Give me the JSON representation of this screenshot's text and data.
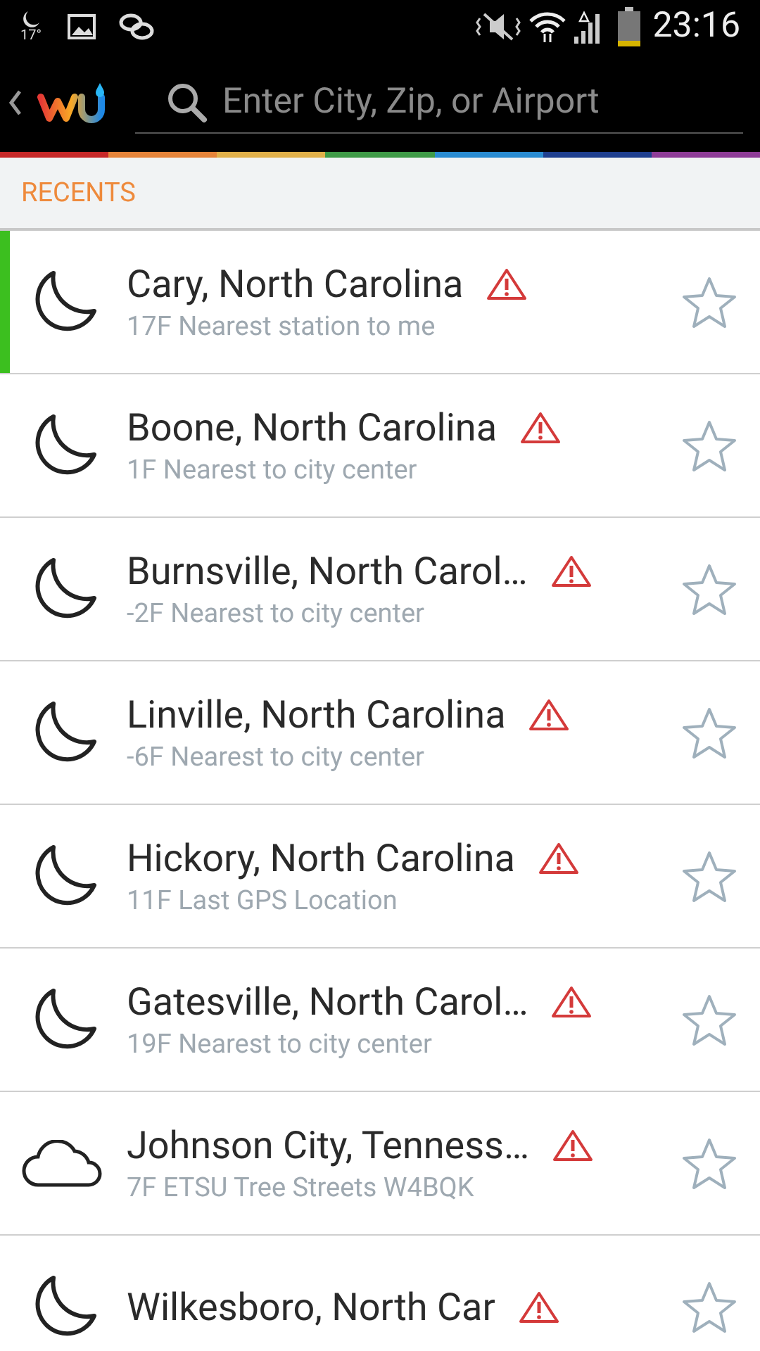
{
  "status_bar": {
    "temperature": "17°",
    "time": "23:16"
  },
  "search": {
    "placeholder": "Enter City, Zip, or Airport"
  },
  "section_title": "RECENTS",
  "locations": [
    {
      "name": "Cary, North Carolina",
      "detail": "17F Nearest station to me",
      "kind": "moon",
      "alert": true,
      "favorite": false,
      "selected": true
    },
    {
      "name": "Boone, North Carolina",
      "detail": "1F Nearest to city center",
      "kind": "moon",
      "alert": true,
      "favorite": false,
      "selected": false
    },
    {
      "name": "Burnsville, North Carol…",
      "detail": "-2F Nearest to city center",
      "kind": "moon",
      "alert": true,
      "favorite": false,
      "selected": false
    },
    {
      "name": "Linville, North Carolina",
      "detail": "-6F Nearest to city center",
      "kind": "moon",
      "alert": true,
      "favorite": false,
      "selected": false
    },
    {
      "name": "Hickory, North Carolina",
      "detail": "11F Last GPS Location",
      "kind": "moon",
      "alert": true,
      "favorite": false,
      "selected": false
    },
    {
      "name": "Gatesville, North Carol…",
      "detail": "19F Nearest to city center",
      "kind": "moon",
      "alert": true,
      "favorite": false,
      "selected": false
    },
    {
      "name": "Johnson City, Tenness…",
      "detail": "7F ETSU Tree Streets W4BQK",
      "kind": "cloud",
      "alert": true,
      "favorite": false,
      "selected": false
    },
    {
      "name": "Wilkesboro, North Car",
      "kind": "moon",
      "alert": true,
      "favorite": false,
      "selected": false
    }
  ]
}
